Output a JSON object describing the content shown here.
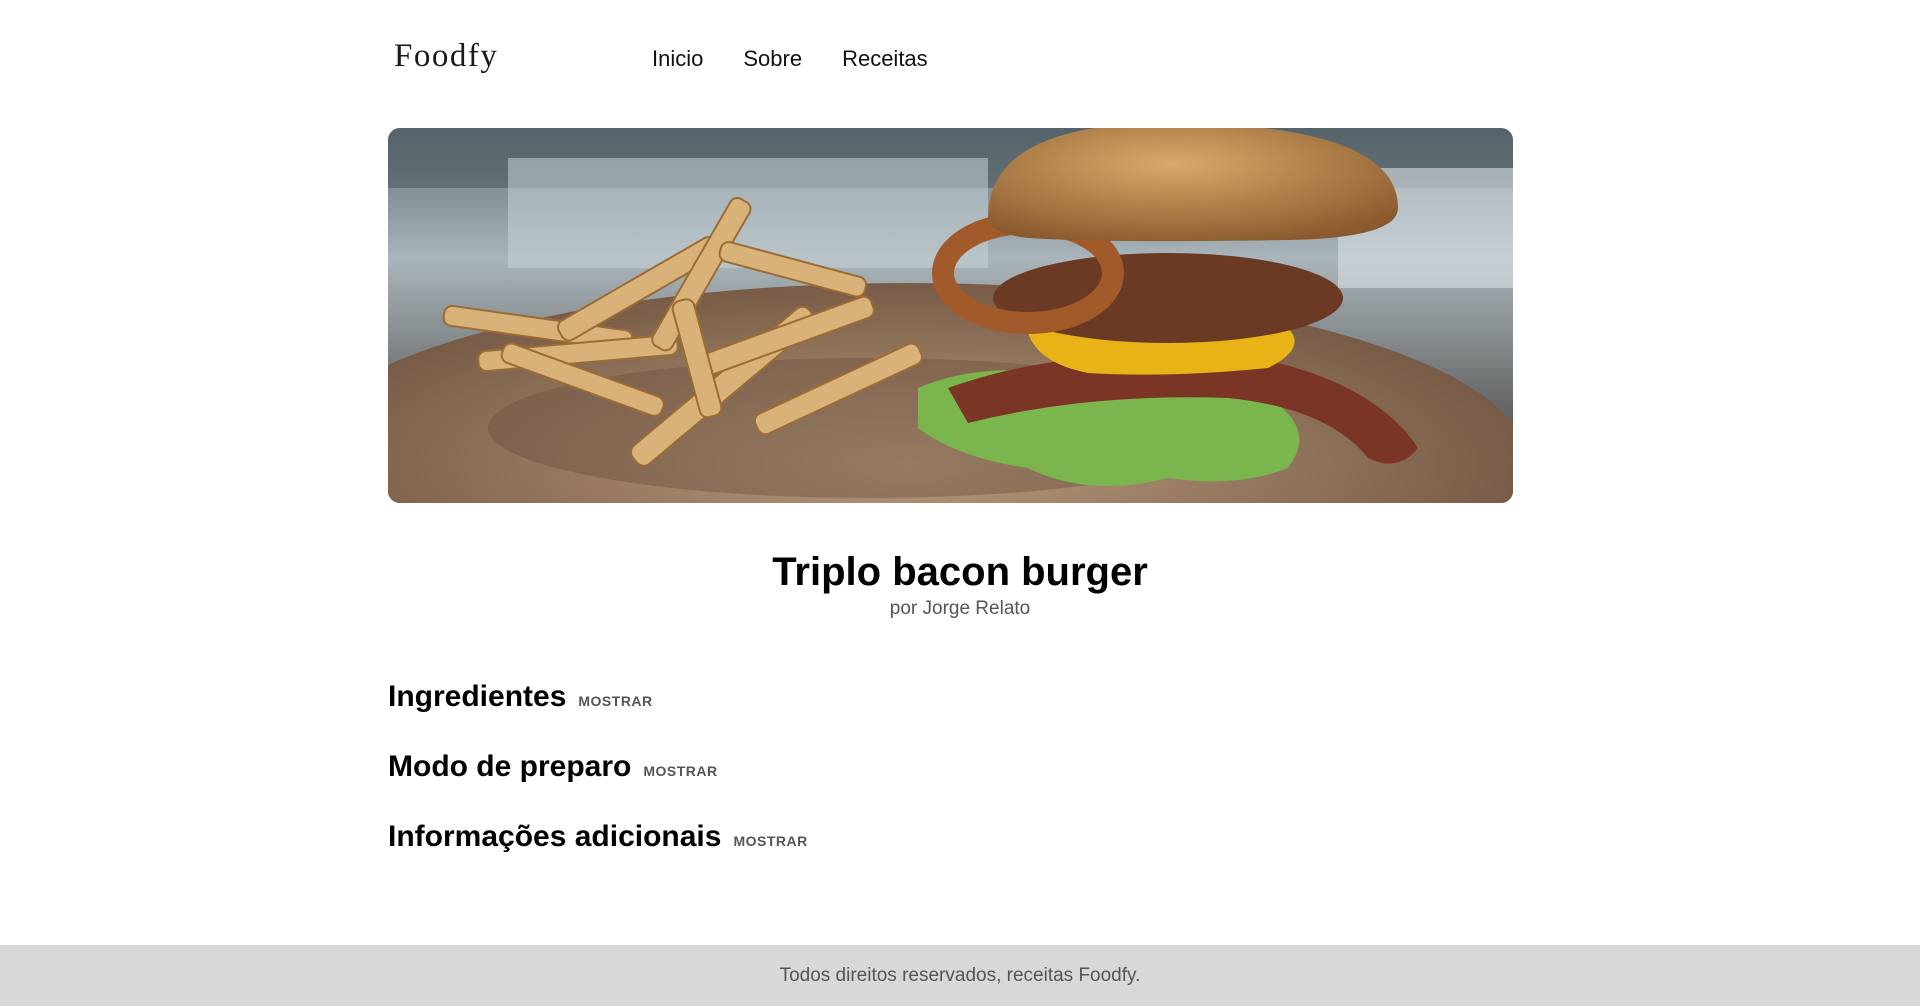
{
  "header": {
    "logo": "Foodfy",
    "nav": [
      {
        "label": "Inicio"
      },
      {
        "label": "Sobre"
      },
      {
        "label": "Receitas"
      }
    ]
  },
  "recipe": {
    "title": "Triplo bacon burger",
    "author": "por Jorge Relato",
    "image_alt": "Triple bacon burger with fries"
  },
  "sections": [
    {
      "heading": "Ingredientes",
      "toggle": "MOSTRAR"
    },
    {
      "heading": "Modo de preparo",
      "toggle": "MOSTRAR"
    },
    {
      "heading": "Informações adicionais",
      "toggle": "MOSTRAR"
    }
  ],
  "footer": {
    "text": "Todos direitos reservados, receitas Foodfy."
  }
}
